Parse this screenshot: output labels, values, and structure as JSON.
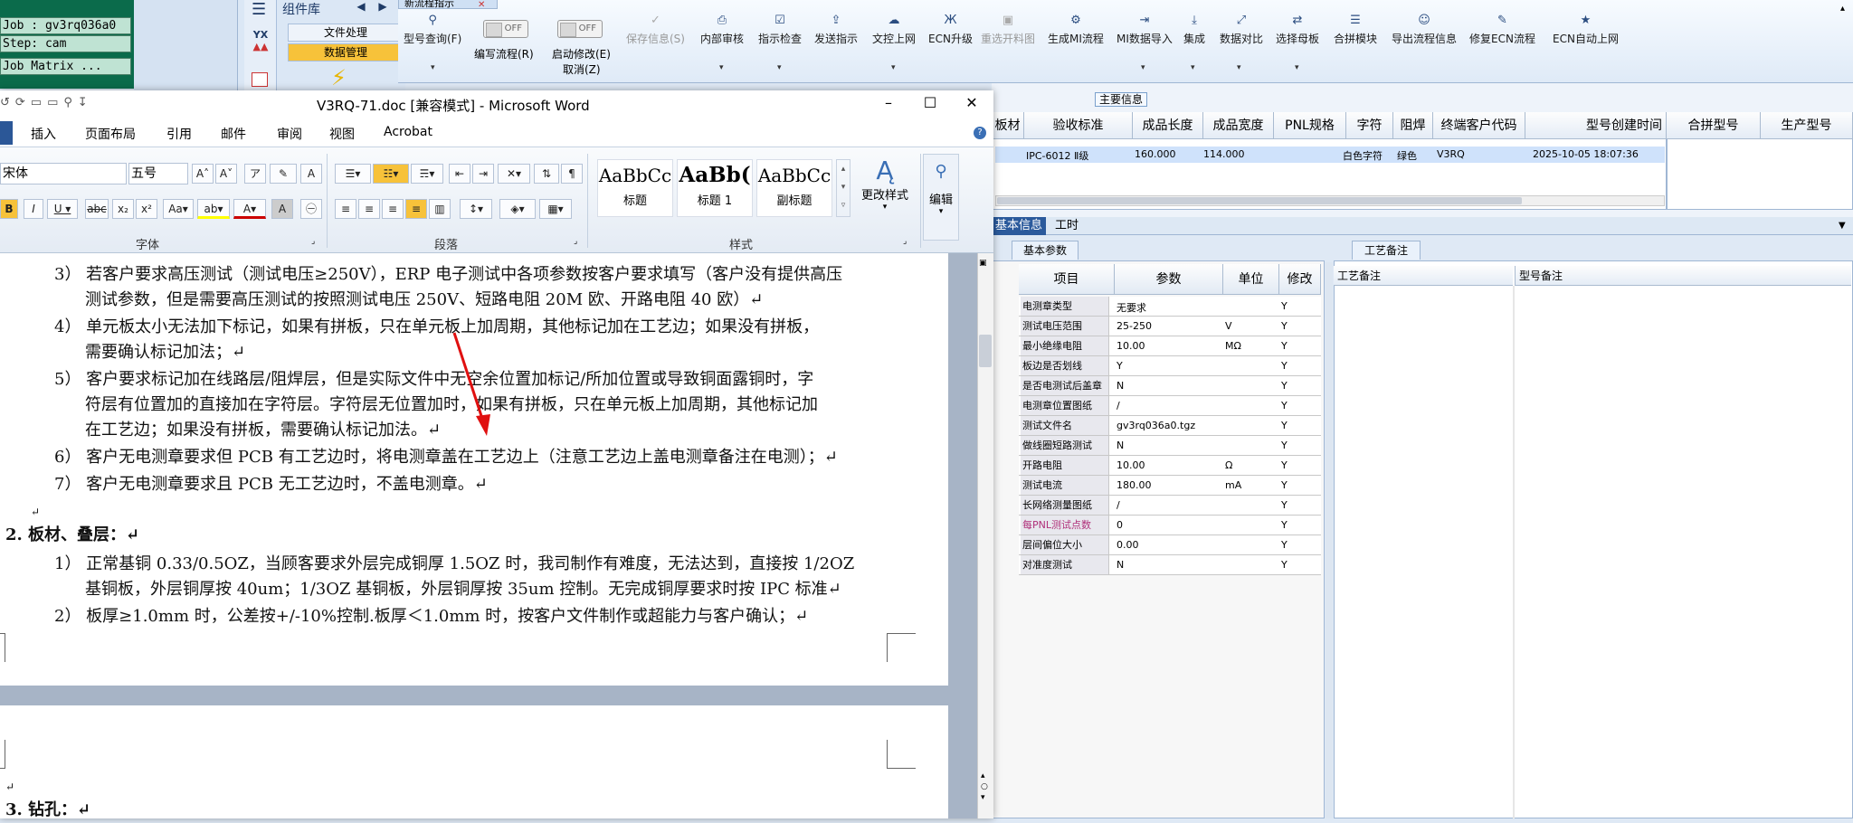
{
  "terminal": {
    "lines": [
      "Job : gv3rq036a0",
      "Step: cam",
      "Job Matrix ..."
    ]
  },
  "component_panel": {
    "title": "组件库",
    "buttons": [
      "文件处理",
      "数据管理"
    ],
    "logo_text": "YX"
  },
  "ribbon": {
    "tab_label": "新流程指示",
    "items": [
      {
        "label": "型号查询(F)",
        "icon": "search-icon",
        "dd": true
      },
      {
        "label": "保存信息(S)",
        "icon": "check-icon",
        "disabled": true
      },
      {
        "label": "内部审核",
        "icon": "printer-icon",
        "dd": true
      },
      {
        "label": "指示检查",
        "icon": "checklist-icon",
        "dd": true
      },
      {
        "label": "发送指示",
        "icon": "upload-icon"
      },
      {
        "label": "文控上网",
        "icon": "cloud-upload-icon",
        "dd": true
      },
      {
        "label": "ECN升级",
        "icon": "ecn-icon"
      },
      {
        "label": "重选开料图",
        "icon": "image-icon",
        "disabled": true
      },
      {
        "label": "生成MI流程",
        "icon": "gears-icon"
      },
      {
        "label": "MI数据导入",
        "icon": "import-icon",
        "dd": true
      },
      {
        "label": "集成",
        "icon": "download-icon",
        "dd": true
      },
      {
        "label": "数据对比",
        "icon": "compare-icon",
        "dd": true
      },
      {
        "label": "选择母板",
        "icon": "shuffle-icon",
        "dd": true
      },
      {
        "label": "合拼模块",
        "icon": "list-icon"
      },
      {
        "label": "导出流程信息",
        "icon": "smile-icon"
      },
      {
        "label": "修复ECN流程",
        "icon": "wrench-icon"
      },
      {
        "label": "ECN自动上网",
        "icon": "star-icon"
      }
    ],
    "toggles": [
      {
        "state": "OFF",
        "label": "编写流程(R)"
      },
      {
        "state": "OFF",
        "label": "启动修改(E)"
      }
    ],
    "cancel_label": "取消(Z)"
  },
  "main_info": {
    "title": "主要信息",
    "columns": [
      "板材",
      "验收标准",
      "成品长度",
      "成品宽度",
      "PNL规格",
      "字符",
      "阻焊",
      "终端客户代码",
      "型号创建时间"
    ],
    "row": [
      "",
      "IPC-6012 Ⅱ级",
      "160.000",
      "114.000",
      "",
      "白色字符",
      "绿色",
      "V3RQ",
      "2025-10-05 18:07:36"
    ],
    "merge_columns": [
      "合拼型号",
      "生产型号"
    ]
  },
  "sub_tabs": [
    "基本信息",
    "工时"
  ],
  "params": {
    "tab": "基本参数",
    "columns": [
      "项目",
      "参数",
      "单位",
      "修改"
    ],
    "rows": [
      [
        "电测章类型",
        "无要求",
        "",
        "Y"
      ],
      [
        "测试电压范围",
        "25-250",
        "V",
        "Y"
      ],
      [
        "最小绝缘电阻",
        "10.00",
        "MΩ",
        "Y"
      ],
      [
        "板边是否划线",
        "Y",
        "",
        "Y"
      ],
      [
        "是否电测试后盖章",
        "N",
        "",
        "Y"
      ],
      [
        "电测章位置图纸",
        "/",
        "",
        "Y"
      ],
      [
        "测试文件名",
        "gv3rq036a0.tgz",
        "",
        "Y"
      ],
      [
        "做线圈短路测试",
        "N",
        "",
        "Y"
      ],
      [
        "开路电阻",
        "10.00",
        "Ω",
        "Y"
      ],
      [
        "测试电流",
        "180.00",
        "mA",
        "Y"
      ],
      [
        "长网络测量图纸",
        "/",
        "",
        "Y"
      ],
      [
        "每PNL测试点数",
        "0",
        "",
        "Y"
      ],
      [
        "层间偏位大小",
        "0.00",
        "",
        "Y"
      ],
      [
        "对准度测试",
        "N",
        "",
        "Y"
      ]
    ]
  },
  "notes": {
    "tab": "工艺备注",
    "col1": "工艺备注",
    "col2": "型号备注"
  },
  "word": {
    "title": "V3RQ-71.doc [兼容模式] - Microsoft Word",
    "tabs": [
      "插入",
      "页面布局",
      "引用",
      "邮件",
      "审阅",
      "视图",
      "Acrobat"
    ],
    "font": "宋体",
    "size": "五号",
    "groups": [
      "字体",
      "段落",
      "样式"
    ],
    "styles": [
      {
        "preview": "AaBbCc",
        "name": "标题"
      },
      {
        "preview": "AaBb(",
        "name": "标题 1"
      },
      {
        "preview": "AaBbCc",
        "name": "副标题"
      }
    ],
    "change_styles": "更改样式",
    "edit": "编辑",
    "doc_lines": [
      "3） 若客户要求高压测试（测试电压≥250V），ERP 电子测试中各项参数按客户要求填写（客户没有提供高压",
      "测试参数，但是需要高压测试的按照测试电压 250V、短路电阻 20M 欧、开路电阻 40 欧）↵",
      "4） 单元板太小无法加下标记，如果有拼板，只在单元板上加周期，其他标记加在工艺边；如果没有拼板，",
      "需要确认标记加法；↵",
      "5） 客户要求标记加在线路层/阻焊层，但是实际文件中无空余位置加标记/所加位置或导致铜面露铜时，字",
      "符层有位置加的直接加在字符层。字符层无位置加时，如果有拼板，只在单元板上加周期，其他标记加",
      "在工艺边；如果没有拼板，需要确认标记加法。↵",
      "6） 客户无电测章要求但 PCB 有工艺边时，将电测章盖在工艺边上（注意工艺边上盖电测章备注在电测）；↵",
      "7） 客户无电测章要求且 PCB 无工艺边时，不盖电测章。↵",
      "↵",
      "2.   板材、叠层：↵",
      "1） 正常基铜 0.33/0.5OZ，当顾客要求外层完成铜厚 1.5OZ 时，我司制作有难度，无法达到，直接按 1/2OZ",
      "基铜板，外层铜厚按 40um；1/3OZ 基铜板，外层铜厚按 35um 控制。无完成铜厚要求时按 IPC 标准↵",
      "2） 板厚≥1.0mm 时，公差按+/-10%控制.板厚＜1.0mm 时，按客户文件制作或超能力与客户确认；↵",
      "↵",
      "3.   钻孔：↵"
    ]
  }
}
